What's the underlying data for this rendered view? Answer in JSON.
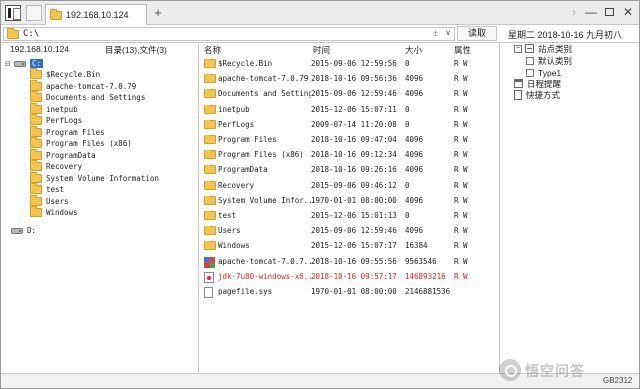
{
  "tabs": {
    "active_label": "192.168.10.124",
    "new_tab_symbol": "+"
  },
  "window_controls": {
    "back": "›",
    "minimize": "—",
    "close": "✕"
  },
  "address": {
    "value": "C:\\",
    "clear_symbol": "±",
    "dropdown_symbol": "∨",
    "read_button": "读取",
    "date_text": "星期二  2018-10-16  九月初八"
  },
  "left_pane": {
    "host": "192.168.10.124",
    "counts": "目录(13),文件(3)",
    "drive_c": "C:",
    "drive_d": "D:",
    "folders": [
      "$Recycle.Bin",
      "apache-tomcat-7.0.79",
      "Documents and Settings",
      "inetpub",
      "PerfLogs",
      "Program Files",
      "Program Files (x86)",
      "ProgramData",
      "Recovery",
      "System Volume Information",
      "test",
      "Users",
      "Windows"
    ]
  },
  "file_list": {
    "headers": {
      "name": "名称",
      "time": "时间",
      "size": "大小",
      "attr": "属性"
    },
    "rows": [
      {
        "icon": "folder-icon",
        "name": "$Recycle.Bin",
        "time": "2015-09-06 12:59:56",
        "size": "0",
        "attr": "R W"
      },
      {
        "icon": "folder-icon",
        "name": "apache-tomcat-7.0.79",
        "time": "2018-10-16 09:56:36",
        "size": "4096",
        "attr": "R W"
      },
      {
        "icon": "folder-icon",
        "name": "Documents and Settings",
        "time": "2015-09-06 12:59:46",
        "size": "4096",
        "attr": "R W"
      },
      {
        "icon": "folder-icon",
        "name": "inetpub",
        "time": "2015-12-06 15:07:11",
        "size": "0",
        "attr": "R W"
      },
      {
        "icon": "folder-icon",
        "name": "PerfLogs",
        "time": "2009-07-14 11:20:08",
        "size": "0",
        "attr": "R W"
      },
      {
        "icon": "folder-icon",
        "name": "Program Files",
        "time": "2018-10-16 09:47:04",
        "size": "4096",
        "attr": "R W"
      },
      {
        "icon": "folder-icon",
        "name": "Program Files (x86)",
        "time": "2018-10-16 09:12:34",
        "size": "4096",
        "attr": "R W"
      },
      {
        "icon": "folder-icon",
        "name": "ProgramData",
        "time": "2018-10-16 09:26:16",
        "size": "4096",
        "attr": "R W"
      },
      {
        "icon": "folder-icon",
        "name": "Recovery",
        "time": "2015-09-06 09:46:12",
        "size": "0",
        "attr": "R W"
      },
      {
        "icon": "folder-icon",
        "name": "System Volume Infor...",
        "time": "1970-01-01 08:00:00",
        "size": "4096",
        "attr": "R W"
      },
      {
        "icon": "folder-icon",
        "name": "test",
        "time": "2015-12-06 15:01:13",
        "size": "0",
        "attr": "R W"
      },
      {
        "icon": "folder-icon",
        "name": "Users",
        "time": "2015-09-06 12:59:46",
        "size": "4096",
        "attr": "R W"
      },
      {
        "icon": "folder-icon",
        "name": "Windows",
        "time": "2015-12-06 15:07:17",
        "size": "16384",
        "attr": "R W"
      },
      {
        "icon": "app-icon",
        "name": "apache-tomcat-7.0.7...",
        "time": "2018-10-16 09:55:56",
        "size": "9563546",
        "attr": "R W"
      },
      {
        "icon": "java-file-icon",
        "name": "jdk-7u80-windows-x6...",
        "time": "2018-10-16 09:57:17",
        "size": "146893216",
        "attr": "R W",
        "highlight": true
      },
      {
        "icon": "file-icon",
        "name": "pagefile.sys",
        "time": "1970-01-01 08:00:00",
        "size": "2146881536",
        "attr": ""
      }
    ]
  },
  "right_pane": {
    "site_category": "站点类别",
    "default_category": "默认类别",
    "type1": "Type1",
    "schedule": "日程提醒",
    "shortcuts": "快捷方式",
    "expander": "−"
  },
  "watermark": {
    "text": "悟空问答",
    "code": "GB2312"
  },
  "colors": {
    "highlight_row": "#e02020",
    "selected_drive": "#2e6fd6",
    "folder": "#f3c54e"
  }
}
